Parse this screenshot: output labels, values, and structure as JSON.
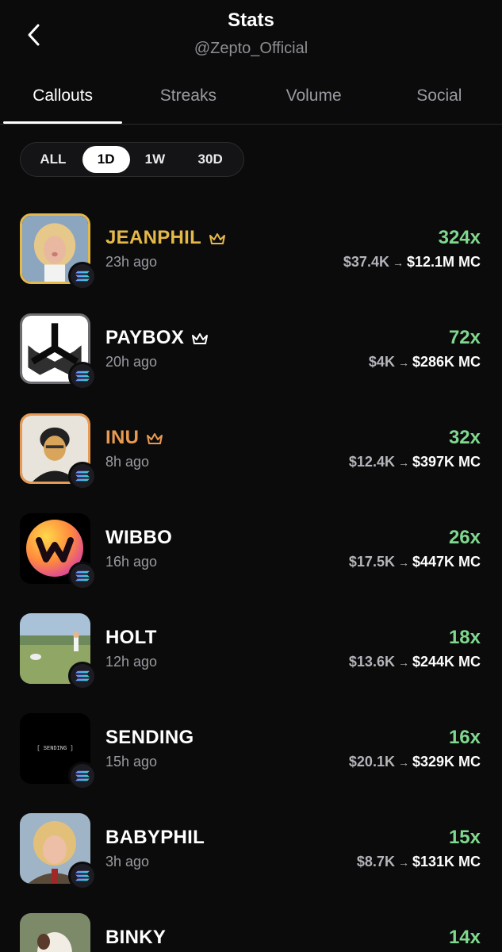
{
  "header": {
    "title": "Stats",
    "subtitle": "@Zepto_Official"
  },
  "tabs": [
    {
      "label": "Callouts",
      "active": true
    },
    {
      "label": "Streaks",
      "active": false
    },
    {
      "label": "Volume",
      "active": false
    },
    {
      "label": "Social",
      "active": false
    }
  ],
  "filters": [
    {
      "label": "ALL",
      "active": false
    },
    {
      "label": "1D",
      "active": true
    },
    {
      "label": "1W",
      "active": false
    },
    {
      "label": "30D",
      "active": false
    }
  ],
  "colors": {
    "gold": "#e5b84a",
    "orange": "#e99a52",
    "green": "#7fd88e",
    "white": "#ffffff",
    "muted": "#9a9aa0"
  },
  "tokens": [
    {
      "name": "JEANPHIL",
      "ago": "23h ago",
      "multiple": "324x",
      "from": "$37.4K",
      "to": "$12.1M MC",
      "crown": true,
      "name_color": "#e5b84a",
      "avatar": "person-blonde-bob-avatar"
    },
    {
      "name": "PAYBOX",
      "ago": "20h ago",
      "multiple": "72x",
      "from": "$4K",
      "to": "$286K MC",
      "crown": true,
      "name_color": "#ffffff",
      "avatar": "paybox-logo-avatar"
    },
    {
      "name": "INU",
      "ago": "8h ago",
      "multiple": "32x",
      "from": "$12.4K",
      "to": "$397K MC",
      "crown": true,
      "name_color": "#e99a52",
      "avatar": "dog-in-suit-avatar"
    },
    {
      "name": "WIBBO",
      "ago": "16h ago",
      "multiple": "26x",
      "from": "$17.5K",
      "to": "$447K MC",
      "crown": false,
      "name_color": "#ffffff",
      "avatar": "wibbo-w-logo-avatar"
    },
    {
      "name": "HOLT",
      "ago": "12h ago",
      "multiple": "18x",
      "from": "$13.6K",
      "to": "$244K MC",
      "crown": false,
      "name_color": "#ffffff",
      "avatar": "field-photo-avatar"
    },
    {
      "name": "SENDING",
      "ago": "15h ago",
      "multiple": "16x",
      "from": "$20.1K",
      "to": "$329K MC",
      "crown": false,
      "name_color": "#ffffff",
      "avatar": "sending-text-avatar",
      "avatar_text": "[ SENDING ]"
    },
    {
      "name": "BABYPHIL",
      "ago": "3h ago",
      "multiple": "15x",
      "from": "$8.7K",
      "to": "$131K MC",
      "crown": false,
      "name_color": "#ffffff",
      "avatar": "child-blonde-avatar"
    },
    {
      "name": "BINKY",
      "ago": "",
      "multiple": "14x",
      "from": "",
      "to": "",
      "crown": false,
      "name_color": "#ffffff",
      "avatar": "calf-photo-avatar"
    }
  ]
}
